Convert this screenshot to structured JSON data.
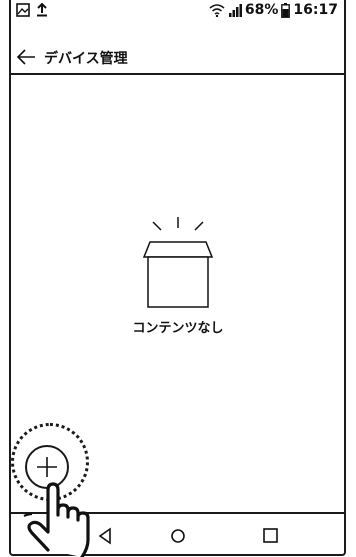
{
  "status_bar": {
    "battery": "68%",
    "time": "16:17",
    "icons": [
      "image-icon",
      "upload-icon",
      "wifi-icon",
      "signal-icon",
      "battery-icon"
    ]
  },
  "app_bar": {
    "title": "デバイス管理",
    "back_icon": "arrow-left-icon"
  },
  "empty_state": {
    "icon": "empty-box-icon",
    "label": "コンテンツなし"
  },
  "fab": {
    "icon": "plus-icon"
  },
  "nav_bar": {
    "buttons": [
      "back-triangle-icon",
      "home-circle-icon",
      "recents-square-icon"
    ]
  },
  "overlay": {
    "icon": "pointing-hand-icon"
  }
}
